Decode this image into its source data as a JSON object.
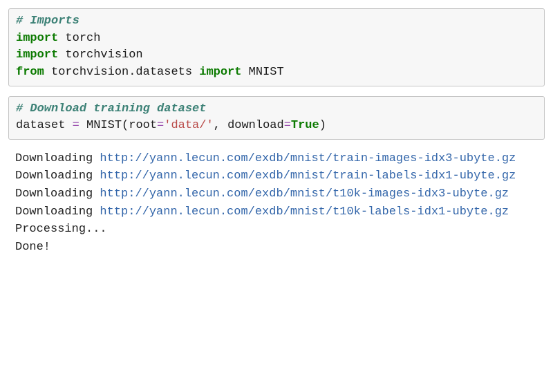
{
  "cell1": {
    "comment": "# Imports",
    "l1_kw": "import",
    "l1_mod": " torch",
    "l2_kw": "import",
    "l2_mod": " torchvision",
    "l3_from": "from",
    "l3_pkg": " torchvision.datasets ",
    "l3_import": "import",
    "l3_name": " MNIST"
  },
  "cell2": {
    "comment": "# Download training dataset",
    "var": "dataset ",
    "eq": "=",
    "call1": " MNIST(root",
    "eq2": "=",
    "str": "'data/'",
    "sep": ", download",
    "eq3": "=",
    "const": "True",
    "close": ")"
  },
  "output": {
    "downloading": "Downloading ",
    "url1": "http://yann.lecun.com/exdb/mnist/train-images-idx3-ubyte.gz",
    "url2": "http://yann.lecun.com/exdb/mnist/train-labels-idx1-ubyte.gz",
    "url3": "http://yann.lecun.com/exdb/mnist/t10k-images-idx3-ubyte.gz",
    "url4": "http://yann.lecun.com/exdb/mnist/t10k-labels-idx1-ubyte.gz",
    "processing": "Processing...",
    "done": "Done!"
  }
}
